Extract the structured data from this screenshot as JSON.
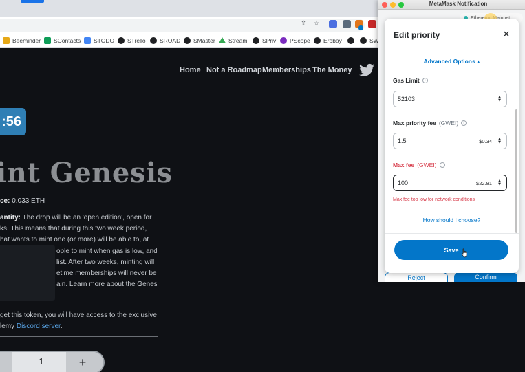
{
  "browser": {
    "bookmarks": [
      {
        "label": "Beeminder",
        "color": "#e6a817"
      },
      {
        "label": "SContacts",
        "color": "#0f9d58"
      },
      {
        "label": "STODO",
        "color": "#4285f4"
      },
      {
        "label": "STrello",
        "color": "#202124"
      },
      {
        "label": "SROAD",
        "color": "#202124"
      },
      {
        "label": "SMaster",
        "color": "#202124"
      },
      {
        "label": "Stream",
        "color": "#34a853"
      },
      {
        "label": "SPriv",
        "color": "#202124"
      },
      {
        "label": "PScope",
        "color": "#7b2cbf"
      },
      {
        "label": "Erobay",
        "color": "#202124"
      },
      {
        "label": "SW",
        "color": "#202124"
      }
    ],
    "icons": [
      "share-icon",
      "star-icon",
      "extension-icon",
      "metamask-fox-icon",
      "extension-badge-icon",
      "shield-icon"
    ]
  },
  "site": {
    "nav": {
      "home": "Home",
      "roadmap": "Not a Roadmap",
      "memberships": "Memberships",
      "money": "The Money"
    },
    "timer": ":56",
    "title": "int Genesis",
    "price_label": "ce:",
    "price_value": "0.033 ETH",
    "desc_label": "antity:",
    "desc_lines": [
      " The drop will be an 'open edition', open for",
      "ks. This means that during this two week period,",
      "hat wants to mint one (or more) will be able to, at",
      "ople to mint when gas is low, and",
      "list. After two weeks, minting will",
      "etime memberships will never be",
      "ain. Learn more about the Genesis"
    ],
    "token_line1": " get this token, you will have access to the exclusive",
    "token_line2_prefix": "lemy ",
    "discord_link": "Discord server",
    "token_line2_suffix": ".",
    "quantity": "1",
    "plus": "+"
  },
  "metamask": {
    "window_title": "MetaMask Notification",
    "network": "Ethereum Mainnet",
    "reject": "Reject",
    "confirm": "Confirm",
    "popover": {
      "title": "Edit priority",
      "close": "✕",
      "advanced_toggle": "Advanced Options ▴",
      "gas_limit": {
        "label": "Gas Limit",
        "value": "52103"
      },
      "max_priority_fee": {
        "label": "Max priority fee",
        "unit": "(GWEI)",
        "value": "1.5",
        "fiat": "$0.34"
      },
      "max_fee": {
        "label": "Max fee",
        "unit": "(GWEI)",
        "value": "100",
        "fiat": "$22.81"
      },
      "error": "Max fee too low for network conditions",
      "help_link": "How should I choose?",
      "save": "Save"
    }
  },
  "colors": {
    "metamask_blue": "#0376c9",
    "error_red": "#d73a49",
    "site_bg": "#0f1115"
  }
}
